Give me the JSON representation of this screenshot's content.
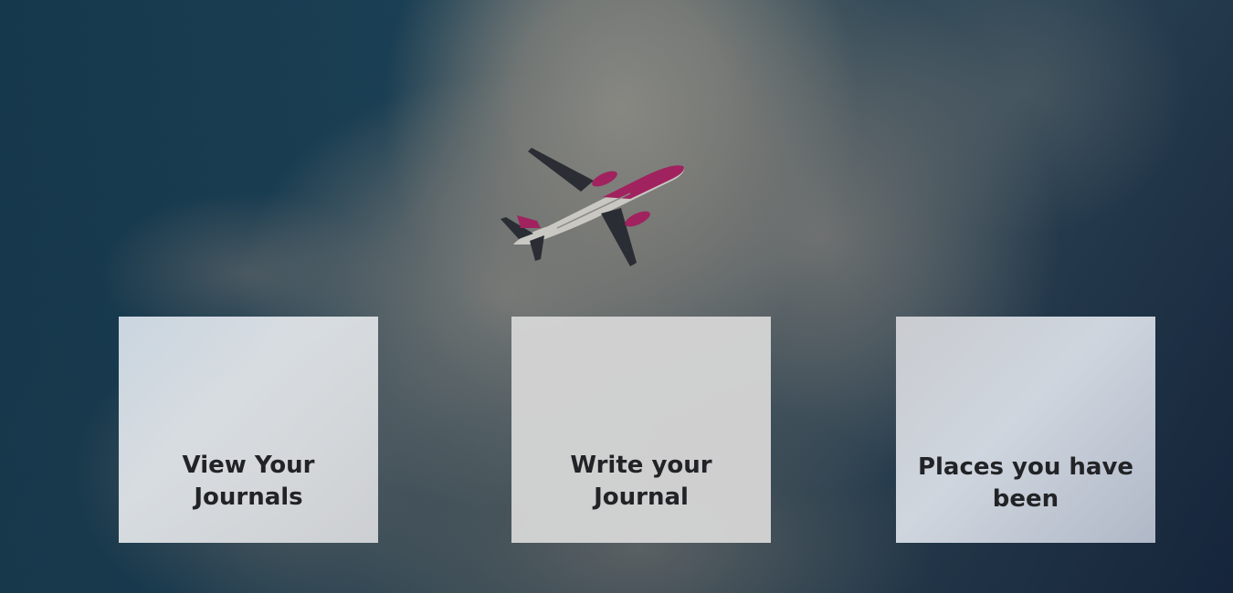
{
  "hero": {
    "image": "airplane-in-cloudy-sky"
  },
  "cards": [
    {
      "label": "View Your Journals"
    },
    {
      "label": "Write your Journal"
    },
    {
      "label": "Places you have been"
    }
  ],
  "colors": {
    "card_text": "#222326",
    "plane_body": "#c9c8c2",
    "plane_accent": "#a0235f"
  }
}
